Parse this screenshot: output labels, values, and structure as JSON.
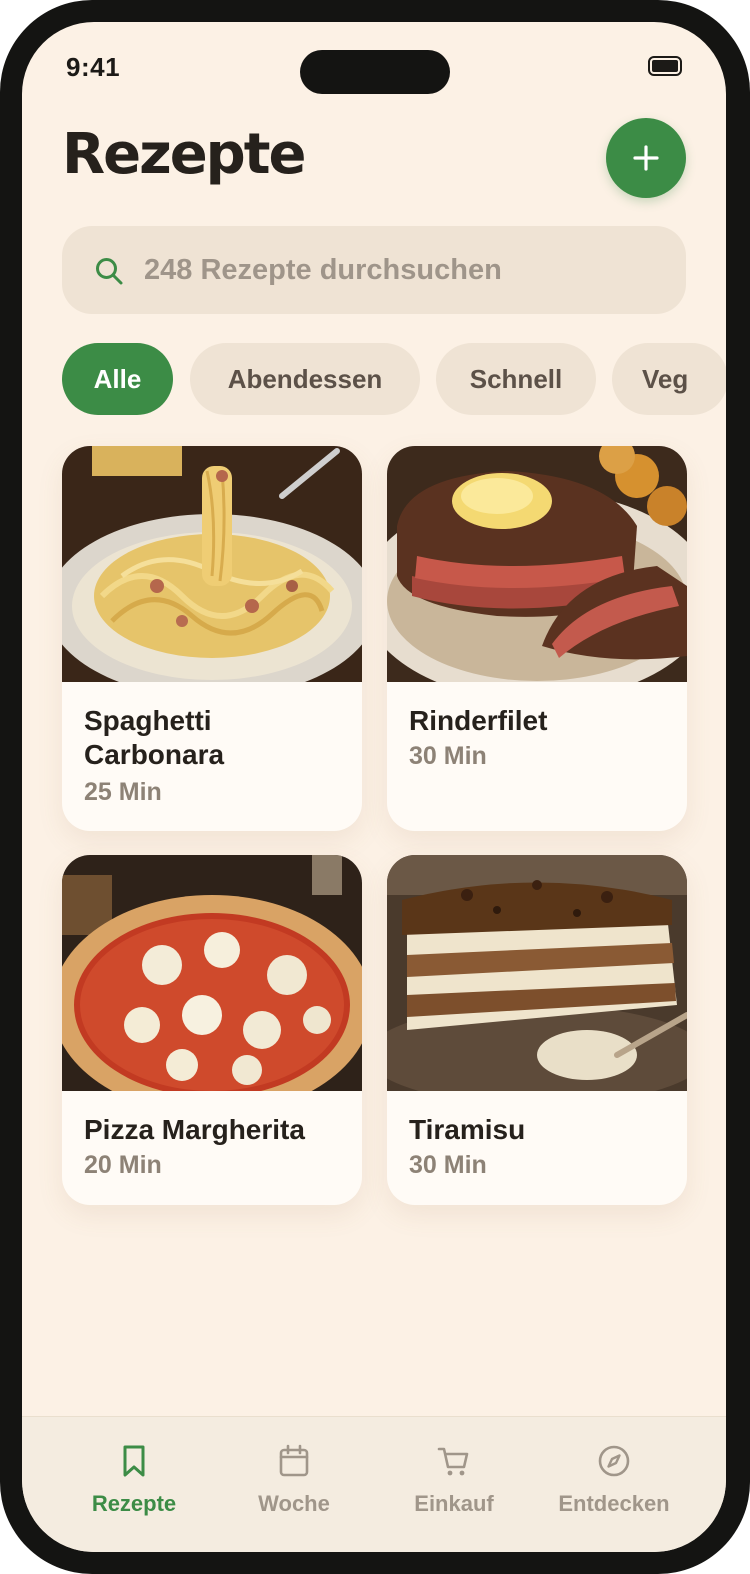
{
  "status_bar": {
    "time": "9:41"
  },
  "header": {
    "title": "Rezepte",
    "add_icon": "plus-icon"
  },
  "search": {
    "placeholder": "248 Rezepte durchsuchen",
    "value": "",
    "icon": "search-icon"
  },
  "filters": [
    {
      "label": "Alle",
      "active": true
    },
    {
      "label": "Abendessen",
      "active": false
    },
    {
      "label": "Schnell",
      "active": false
    },
    {
      "label": "Veg",
      "active": false
    }
  ],
  "recipes": [
    {
      "title": "Spaghetti Carbonara",
      "time": "25 Min"
    },
    {
      "title": "Rinderfilet",
      "time": "30 Min"
    },
    {
      "title": "Pizza Margherita",
      "time": "20 Min"
    },
    {
      "title": "Tiramisu",
      "time": "30 Min"
    }
  ],
  "bottom_nav": [
    {
      "label": "Rezepte",
      "icon": "bookmark-icon",
      "active": true
    },
    {
      "label": "Woche",
      "icon": "calendar-icon",
      "active": false
    },
    {
      "label": "Einkauf",
      "icon": "cart-icon",
      "active": false
    },
    {
      "label": "Entdecken",
      "icon": "compass-icon",
      "active": false
    }
  ],
  "colors": {
    "accent": "#3c8c46",
    "background": "#fcf1e5",
    "chip_bg": "#efe3d4",
    "text_dark": "#26211c",
    "text_muted": "#8d8276"
  }
}
